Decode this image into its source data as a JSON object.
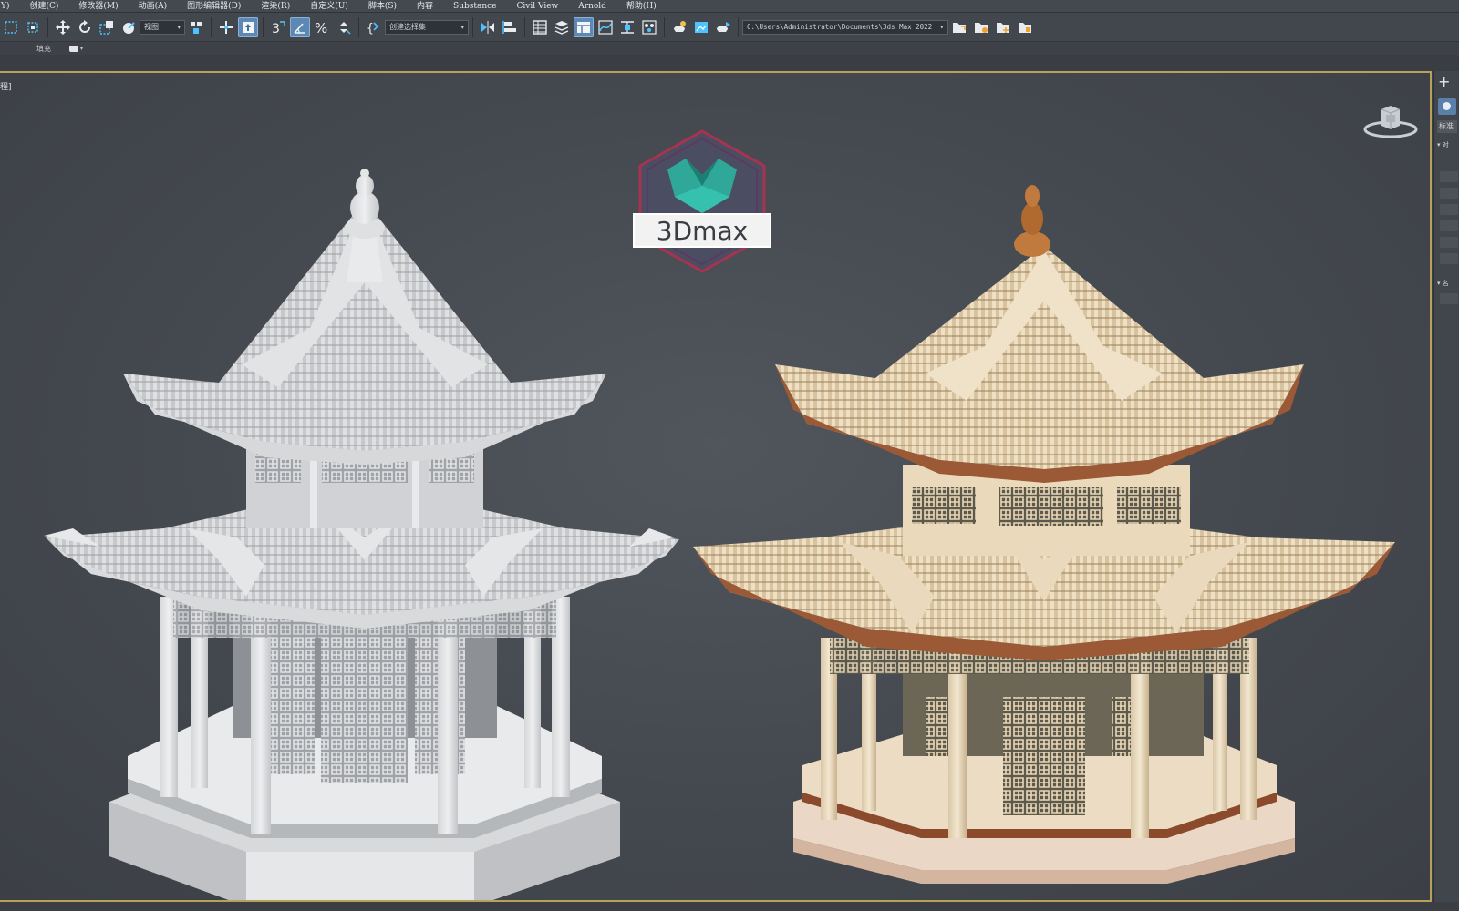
{
  "menu": {
    "items": [
      "Y)",
      "创建(C)",
      "修改器(M)",
      "动画(A)",
      "图形编辑器(D)",
      "渲染(R)",
      "自定义(U)",
      "脚本(S)",
      "内容",
      "Substance",
      "Civil View",
      "Arnold",
      "帮助(H)"
    ]
  },
  "toolbar": {
    "view_dropdown": "视图",
    "selection_set_dropdown": "创建选择集",
    "project_path": "C:\\Users\\Administrator\\Documents\\3ds Max 2022"
  },
  "ribbon": {
    "fill_label": "填充"
  },
  "viewport": {
    "label": "程]",
    "logo_text": "3Dmax"
  },
  "command_panel": {
    "plus": "+",
    "dropdown_label": "标准",
    "rollout_1": "▾ 对",
    "rollout_2": "▾ 名"
  },
  "colors": {
    "accent": "#5d88b4",
    "viewport_border": "#b8a25a",
    "logo_teal": "#2fa89a",
    "logo_hex": "#a8334f"
  }
}
